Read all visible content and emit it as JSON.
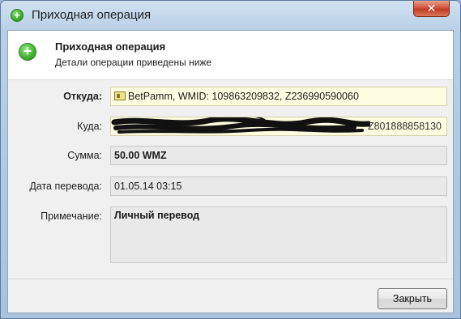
{
  "window": {
    "title": "Приходная операция",
    "close_label": "✕"
  },
  "header": {
    "title": "Приходная операция",
    "subtitle": "Детали операции приведены ниже",
    "icon": "plus-circle-icon"
  },
  "fields": {
    "from": {
      "label": "Откуда:",
      "value": "BetPamm, WMID: 109863209832, Z236990590060",
      "icon": "wmid-card-icon"
    },
    "to": {
      "label": "Куда:",
      "value": "Z801888858130",
      "redacted": true
    },
    "amount": {
      "label": "Сумма:",
      "value": "50.00 WMZ"
    },
    "date": {
      "label": "Дата перевода:",
      "value": "01.05.14 03:15"
    },
    "note": {
      "label": "Примечание:",
      "value": "Личный перевод"
    }
  },
  "buttons": {
    "close": "Закрыть"
  },
  "colors": {
    "accent_green": "#3fae2f",
    "highlight_field": "#fffde1",
    "close_button": "#c23b22"
  }
}
